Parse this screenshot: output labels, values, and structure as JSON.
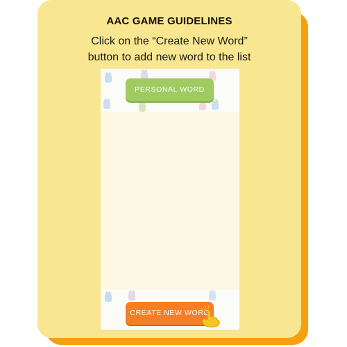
{
  "guide": {
    "title": "AAC GAME GUIDELINES",
    "instruction_line1": "Click on the “Create New Word”",
    "instruction_line2": "button to add new word to the list"
  },
  "app": {
    "personal_word_label": "PERSONAL WORD",
    "create_new_word_label": "CREATE NEW WORD"
  },
  "colors": {
    "card_background": "#f9e690",
    "card_shadow": "#f5a011",
    "personal_button": "#a0cb62",
    "create_button": "#f77d27"
  },
  "icons": {
    "pointer": "pointing-hand-icon"
  }
}
